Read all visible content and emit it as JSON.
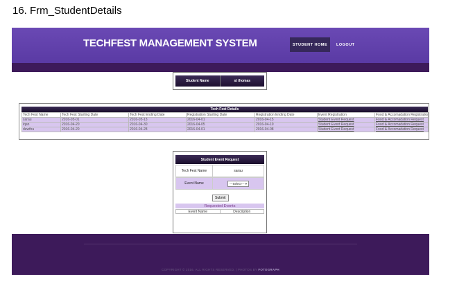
{
  "doc_title": "16. Frm_StudentDetails",
  "header": {
    "app_title": "TECHFEST MANAGEMENT SYSTEM",
    "nav": {
      "home": "STUDENT HOME",
      "logout": "LOGOUT"
    }
  },
  "student": {
    "label": "Student Name",
    "value": "st thomas"
  },
  "events": {
    "title": "Tech Fest Details",
    "columns": [
      "Tech Fest Name",
      "Tech Fest Starting Date",
      "Tech Fest Ending Date",
      "Registration Starting Date",
      "Registration Ending Date",
      "Event Registration",
      "Food & Accomadation Registration"
    ],
    "rows": [
      [
        "sarau",
        "2016-05-01",
        "2016-05-13",
        "2016-04-01",
        "2016-04-15",
        "Student Event Request",
        "Food & Accomadation Request"
      ],
      [
        "iqan",
        "2016-04-20",
        "2016-04-30",
        "2016-04-05",
        "2016-04-10",
        "Student Event Request",
        "Food & Accomadation Request"
      ],
      [
        "dewthu",
        "2016-04-20",
        "2016-04-28",
        "2016-04-01",
        "2016-04-08",
        "Student Event Request",
        "Food & Accomadation Request"
      ]
    ]
  },
  "request": {
    "title": "Student Event Request",
    "fest_label": "Tech Fest Name",
    "fest_value": "sarau",
    "event_label": "Event Name",
    "event_select": "---Select---",
    "submit": "Submit",
    "requested_title": "Requested Events",
    "requested_columns": [
      "Event Name",
      "Description"
    ]
  },
  "footer": {
    "copyright": "COPYRIGHT © 2016. ALL RIGHTS RESERVED. | PHOTOS BY",
    "photos_by": "FOTOGRAPH"
  },
  "colors": {
    "header": "#5a3aa4",
    "dark_band": "#3d1a5a",
    "row_highlight": "#d8c6ef"
  }
}
